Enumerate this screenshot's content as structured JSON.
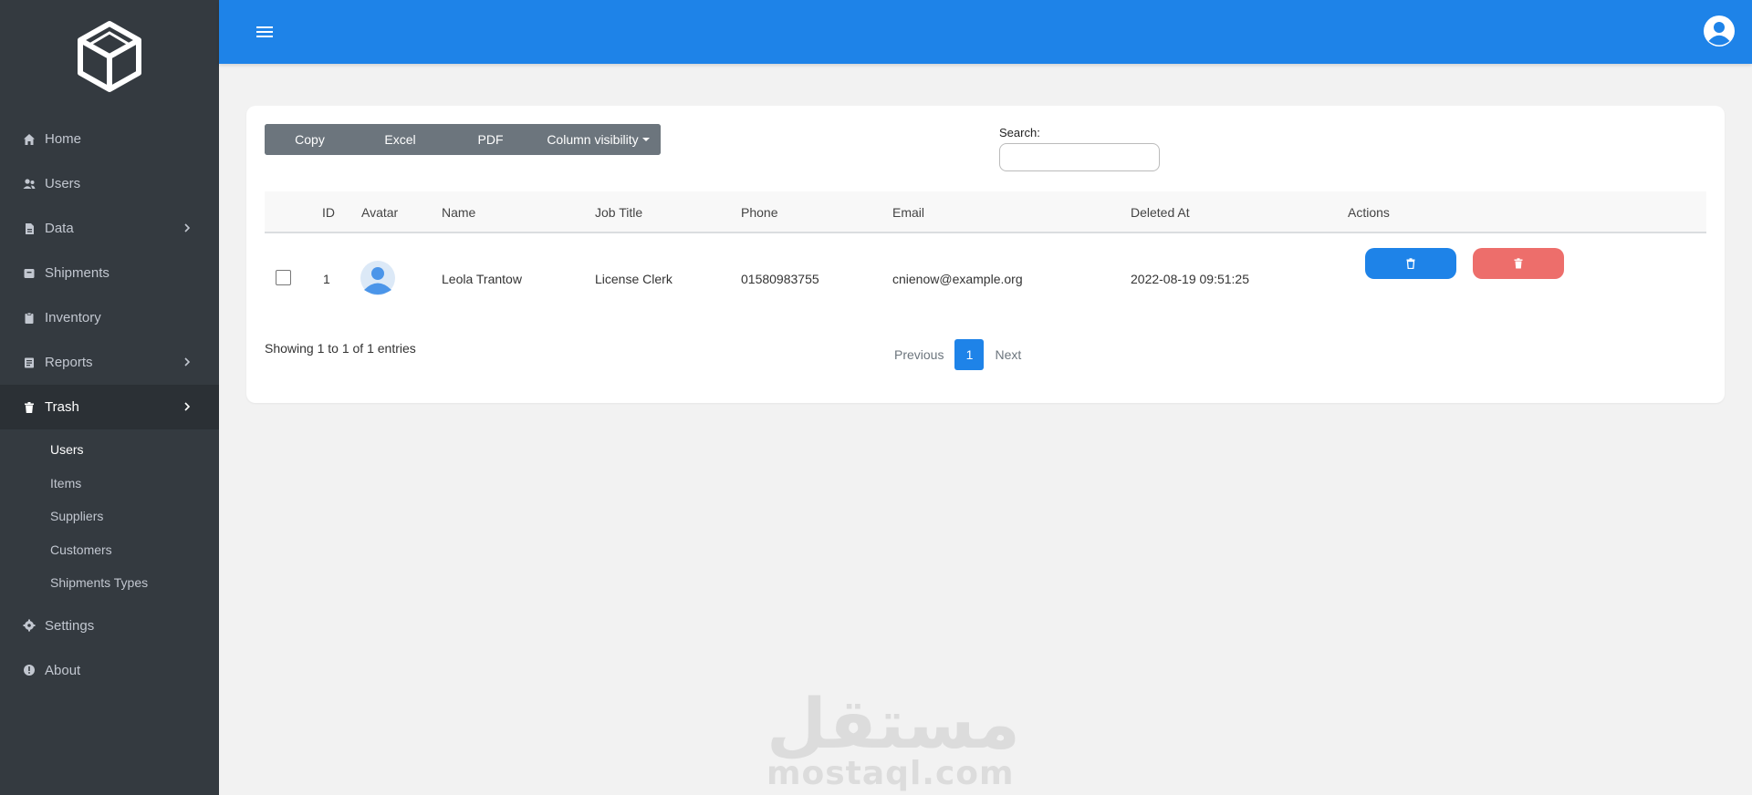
{
  "sidebar": {
    "logo_icon": "cube-icon",
    "items": [
      {
        "label": "Home",
        "icon": "home-icon"
      },
      {
        "label": "Users",
        "icon": "users-icon"
      },
      {
        "label": "Data",
        "icon": "file-icon",
        "has_children": true
      },
      {
        "label": "Shipments",
        "icon": "box-icon"
      },
      {
        "label": "Inventory",
        "icon": "clipboard-icon"
      },
      {
        "label": "Reports",
        "icon": "report-icon",
        "has_children": true
      },
      {
        "label": "Trash",
        "icon": "trash-icon",
        "has_children": true,
        "active": true
      }
    ],
    "trash_children": [
      "Users",
      "Items",
      "Suppliers",
      "Customers",
      "Shipments Types"
    ],
    "trash_current": "Users",
    "bottom_items": [
      {
        "label": "Settings",
        "icon": "gear-icon"
      },
      {
        "label": "About",
        "icon": "info-icon"
      }
    ]
  },
  "topbar": {
    "menu_icon": "hamburger-icon",
    "user_icon": "user-avatar-icon",
    "color": "#1e83e8"
  },
  "toolbar": {
    "copy": "Copy",
    "excel": "Excel",
    "pdf": "PDF",
    "column_visibility": "Column visibility"
  },
  "search": {
    "label": "Search:",
    "value": ""
  },
  "table": {
    "columns": [
      "ID",
      "Avatar",
      "Name",
      "Job Title",
      "Phone",
      "Email",
      "Deleted At",
      "Actions"
    ],
    "rows": [
      {
        "checked": false,
        "id": "1",
        "avatar_icon": "user-placeholder-icon",
        "name": "Leola Trantow",
        "job_title": "License Clerk",
        "phone": "01580983755",
        "email": "cnienow@example.org",
        "deleted_at": "2022-08-19 09:51:25",
        "actions": [
          "restore-icon",
          "delete-icon"
        ]
      }
    ]
  },
  "footer": {
    "info": "Showing 1 to 1 of 1 entries",
    "previous": "Previous",
    "current_page": "1",
    "next": "Next"
  },
  "watermark": {
    "arabic": "مستقل",
    "latin": "mostaql.com"
  },
  "colors": {
    "sidebar": "#343a40",
    "primary": "#1e83e8",
    "danger": "#ed6e6b",
    "secondary": "#6c757d"
  }
}
